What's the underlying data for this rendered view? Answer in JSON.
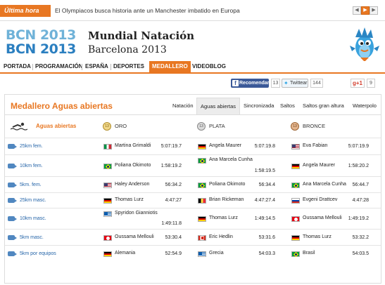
{
  "news": {
    "tag": "Última hora",
    "headline": "El Olympiacos busca historia ante un Manchester imbatido en Europa",
    "prev_icon": "chevron-left-icon",
    "play_icon": "play-icon",
    "next_icon": "chevron-right-icon"
  },
  "header": {
    "logo_line1": "BCN 2013",
    "logo_line2": "BCN 2013",
    "title": "Mundial Natación",
    "subtitle": "Barcelona 2013"
  },
  "nav": {
    "items": [
      "PORTADA",
      "PROGRAMACIÓN",
      "ESPAÑA",
      "DEPORTES",
      "MEDALLERO",
      "VIDEOBLOG"
    ],
    "active": "MEDALLERO"
  },
  "social": {
    "facebook_label": "Recomendar",
    "facebook_count": "13",
    "twitter_label": "Twittear",
    "twitter_count": "144",
    "gplus_label": "g+1",
    "gplus_count": "9"
  },
  "medal_table": {
    "title": "Medallero Aguas abiertas",
    "tabs": [
      "Natación",
      "Aguas abiertas",
      "Sincronizada",
      "Saltos",
      "Saltos gran altura",
      "Waterpolo"
    ],
    "active_tab": "Aguas abiertas",
    "event_header": "Aguas abiertas",
    "gold_header": "ORO",
    "silver_header": "PLATA",
    "bronze_header": "BRONCE",
    "medal_glyph": "13",
    "colors": {
      "accent": "#e87722",
      "link": "#2464a8"
    },
    "rows": [
      {
        "event": "25km fem.",
        "gold": {
          "name": "Martina Grimaldi",
          "time": "5:07:19.7",
          "flag": "italy"
        },
        "silver": {
          "name": "Angela Maurer",
          "time": "5:07:19.8",
          "flag": "germany"
        },
        "bronze": {
          "name": "Eva Fabian",
          "time": "5:07:19.9",
          "flag": "usa"
        }
      },
      {
        "event": "10km fem.",
        "gold": {
          "name": "Poliana Okimoto",
          "time": "1:58:19.2",
          "flag": "brazil"
        },
        "silver": {
          "name": "Ana Marcela Cunha",
          "time": "1:58:19.5",
          "flag": "brazil"
        },
        "bronze": {
          "name": "Angela Maurer",
          "time": "1:58:20.2",
          "flag": "germany"
        }
      },
      {
        "event": "5km. fem.",
        "gold": {
          "name": "Haley Anderson",
          "time": "56:34.2",
          "flag": "usa"
        },
        "silver": {
          "name": "Poliana Okimoto",
          "time": "56:34.4",
          "flag": "brazil"
        },
        "bronze": {
          "name": "Ana Marcela Cunha",
          "time": "56:44.7",
          "flag": "brazil"
        }
      },
      {
        "event": "25km masc.",
        "gold": {
          "name": "Thomas Lurz",
          "time": "4:47:27",
          "flag": "germany"
        },
        "silver": {
          "name": "Brian Rickeman",
          "time": "4:47:27.4",
          "flag": "belgium"
        },
        "bronze": {
          "name": "Evgeni Drattcev",
          "time": "4:47:28",
          "flag": "russia"
        }
      },
      {
        "event": "10km masc.",
        "gold": {
          "name": "Spyridon Gianniotis",
          "time": "1:49:11.8",
          "flag": "greece"
        },
        "silver": {
          "name": "Thomas Lurz",
          "time": "1:49:14.5",
          "flag": "germany"
        },
        "bronze": {
          "name": "Oussama Mellouli",
          "time": "1:49:19.2",
          "flag": "tunisia"
        }
      },
      {
        "event": "5km masc.",
        "gold": {
          "name": "Oussama Mellouli",
          "time": "53:30.4",
          "flag": "tunisia"
        },
        "silver": {
          "name": "Eric Hedlin",
          "time": "53:31.6",
          "flag": "canada"
        },
        "bronze": {
          "name": "Thomas Lurz",
          "time": "53:32.2",
          "flag": "germany"
        }
      },
      {
        "event": "5km por equipos",
        "gold": {
          "name": "Alemania",
          "time": "52:54.9",
          "flag": "germany"
        },
        "silver": {
          "name": "Grecia",
          "time": "54:03.3",
          "flag": "greece"
        },
        "bronze": {
          "name": "Brasil",
          "time": "54:03.5",
          "flag": "brazil"
        }
      }
    ]
  }
}
